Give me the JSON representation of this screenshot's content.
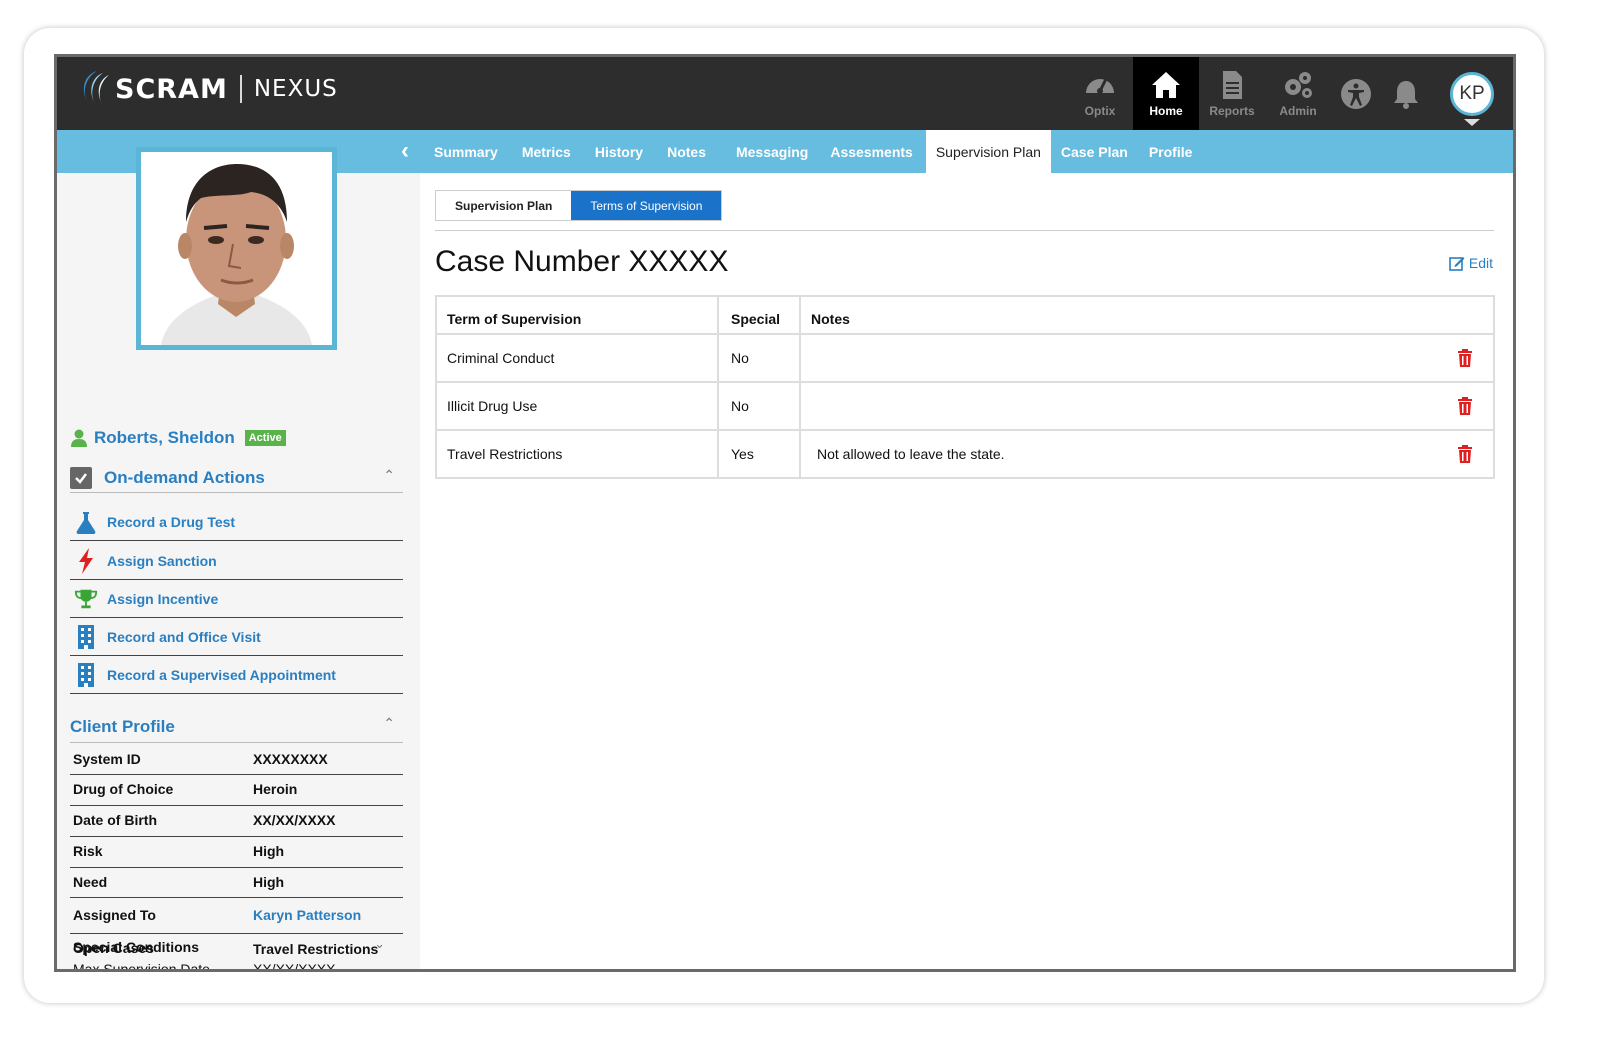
{
  "brand": {
    "name": "SCRAM",
    "product": "NEXUS"
  },
  "topnav": {
    "items": [
      {
        "label": "Optix",
        "icon": "gauge-icon"
      },
      {
        "label": "Home",
        "icon": "home-icon",
        "active": true
      },
      {
        "label": "Reports",
        "icon": "document-icon"
      },
      {
        "label": "Admin",
        "icon": "gears-icon"
      }
    ],
    "accessibility_icon": "accessibility-icon",
    "bell_icon": "bell-icon",
    "user_initials": "KP"
  },
  "subnav": {
    "tabs": [
      "Summary",
      "Metrics",
      "History",
      "Notes",
      "Messaging",
      "Assesments",
      "Supervision Plan",
      "Case Plan",
      "Profile"
    ],
    "active": "Supervision Plan"
  },
  "client": {
    "name": "Roberts, Sheldon",
    "status": "Active"
  },
  "actions": {
    "title": "On-demand Actions",
    "items": [
      {
        "label": "Record a Drug Test",
        "icon": "flask-icon"
      },
      {
        "label": "Assign Sanction",
        "icon": "lightning-icon"
      },
      {
        "label": "Assign Incentive",
        "icon": "trophy-icon"
      },
      {
        "label": "Record and Office Visit",
        "icon": "building-icon"
      },
      {
        "label": "Record a Supervised Appointment",
        "icon": "building-icon"
      }
    ]
  },
  "profile": {
    "title": "Client Profile",
    "rows": [
      {
        "key": "System ID",
        "value": "XXXXXXXX"
      },
      {
        "key": "Drug of Choice",
        "value": "Heroin"
      },
      {
        "key": "Date of Birth",
        "value": "XX/XX/XXXX"
      },
      {
        "key": "Risk",
        "value": "High"
      },
      {
        "key": "Need",
        "value": "High"
      },
      {
        "key": "Assigned To",
        "value": "Karyn Patterson"
      }
    ],
    "open_cases": {
      "label": "Open Cases",
      "sub_label": "Max Supervision Date",
      "sub_value": "XX/XX/XXXX"
    },
    "special_conditions": {
      "key": "Special Conditions",
      "value": "Travel Restrictions"
    }
  },
  "main": {
    "toggle": [
      "Supervision Plan",
      "Terms of Supervision"
    ],
    "toggle_active": "Terms of Supervision",
    "case_title": "Case Number XXXXX",
    "edit_label": "Edit",
    "table": {
      "headers": [
        "Term of Supervision",
        "Special",
        "Notes"
      ],
      "rows": [
        {
          "term": "Criminal Conduct",
          "special": "No",
          "notes": ""
        },
        {
          "term": "Illicit Drug Use",
          "special": "No",
          "notes": ""
        },
        {
          "term": "Travel Restrictions",
          "special": "Yes",
          "notes": "Not allowed to leave the state."
        }
      ]
    }
  },
  "colors": {
    "header_bg": "#2d2d2d",
    "subnav_bg": "#66bde0",
    "link_blue": "#2a7fc1",
    "active_green": "#5ab34a",
    "delete_red": "#e02020",
    "toggle_active": "#1a73c8"
  }
}
